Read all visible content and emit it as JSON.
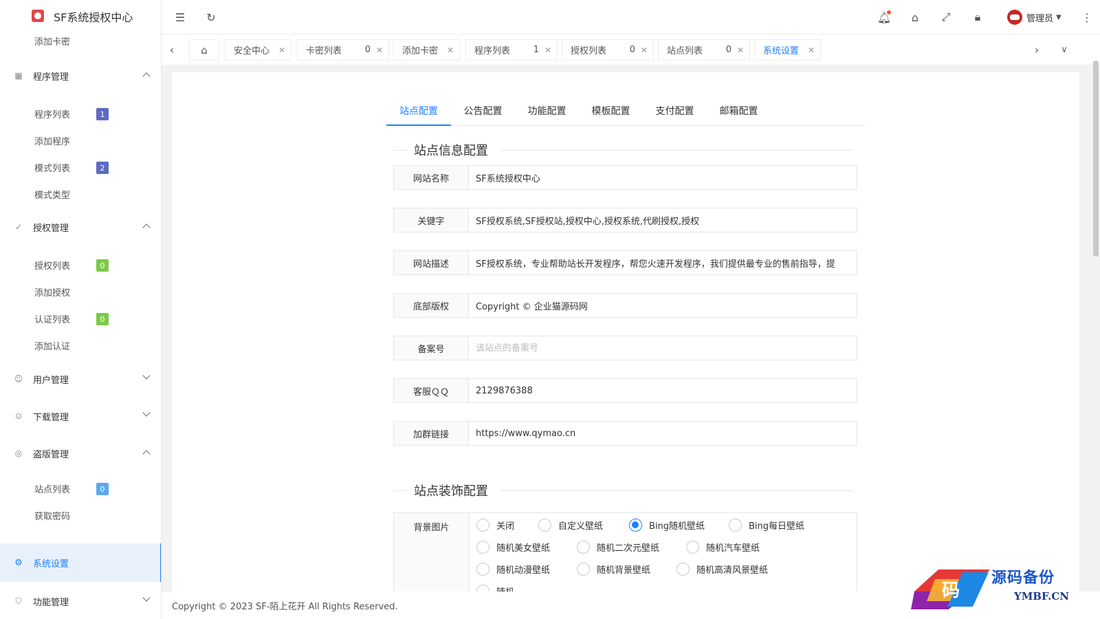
{
  "app": {
    "title": "SF系统授权中心"
  },
  "sidebar": {
    "top_item": "添加卡密",
    "groups": [
      {
        "label": "程序管理",
        "icon": "grid-icon",
        "expanded": true,
        "items": [
          {
            "label": "程序列表",
            "badge": "1",
            "badge_color": "#5c6bc0"
          },
          {
            "label": "添加程序"
          },
          {
            "label": "模式列表",
            "badge": "2",
            "badge_color": "#5c6bc0"
          },
          {
            "label": "模式类型"
          }
        ]
      },
      {
        "label": "授权管理",
        "icon": "check-circle-icon",
        "expanded": true,
        "items": [
          {
            "label": "授权列表",
            "badge": "0",
            "badge_color": "#7cc94a"
          },
          {
            "label": "添加授权"
          },
          {
            "label": "认证列表",
            "badge": "0",
            "badge_color": "#7cc94a"
          },
          {
            "label": "添加认证"
          }
        ]
      },
      {
        "label": "用户管理",
        "icon": "user-icon",
        "expanded": false
      },
      {
        "label": "下载管理",
        "icon": "download-icon",
        "expanded": false
      },
      {
        "label": "盗版管理",
        "icon": "globe-icon",
        "expanded": true,
        "items": [
          {
            "label": "站点列表",
            "badge": "0",
            "badge_color": "#5aa9f0"
          },
          {
            "label": "获取密码"
          }
        ]
      },
      {
        "label": "系统设置",
        "icon": "gear-icon",
        "active": true
      },
      {
        "label": "功能管理",
        "icon": "shield-icon",
        "expanded": false
      }
    ]
  },
  "topbar": {
    "user": "管理员"
  },
  "tabs": [
    {
      "label": "安全中心",
      "count": ""
    },
    {
      "label": "卡密列表",
      "count": "0"
    },
    {
      "label": "添加卡密",
      "count": ""
    },
    {
      "label": "程序列表",
      "count": "1"
    },
    {
      "label": "授权列表",
      "count": "0"
    },
    {
      "label": "站点列表",
      "count": "0"
    },
    {
      "label": "系统设置",
      "count": "",
      "active": true
    }
  ],
  "config_tabs": [
    "站点配置",
    "公告配置",
    "功能配置",
    "模板配置",
    "支付配置",
    "邮箱配置"
  ],
  "site_info": {
    "title": "站点信息配置",
    "fields": [
      {
        "label": "网站名称",
        "value": "SF系统授权中心",
        "placeholder": ""
      },
      {
        "label": "关键字",
        "value": "SF授权系统,SF授权站,授权中心,授权系统,代刷授权,授权",
        "placeholder": ""
      },
      {
        "label": "网站描述",
        "value": "SF授权系统，专业帮助站长开发程序，帮您火速开发程序，我们提供最专业的售前指导，提",
        "placeholder": ""
      },
      {
        "label": "底部版权",
        "value": "Copyright © 企业猫源码网",
        "placeholder": ""
      },
      {
        "label": "备案号",
        "value": "",
        "placeholder": "该站点的备案号"
      },
      {
        "label": "客服ＱＱ",
        "value": "2129876388",
        "placeholder": ""
      },
      {
        "label": "加群链接",
        "value": "https://www.qymao.cn",
        "placeholder": ""
      }
    ]
  },
  "decor": {
    "title": "站点装饰配置",
    "bg_label": "背景图片",
    "options": [
      "关闭",
      "自定义壁纸",
      "Bing随机壁纸",
      "Bing每日壁纸",
      "随机美女壁纸",
      "随机二次元壁纸",
      "随机汽车壁纸",
      "随机动漫壁纸",
      "随机背景壁纸",
      "随机高清风景壁纸",
      "随机..."
    ],
    "selected": "Bing随机壁纸"
  },
  "footer": {
    "text": "Copyright © 2023 SF-陌上花开 All Rights Reserved."
  },
  "watermark": {
    "title": "源码备份",
    "domain": "YMBF.CN",
    "glyph": "码"
  }
}
